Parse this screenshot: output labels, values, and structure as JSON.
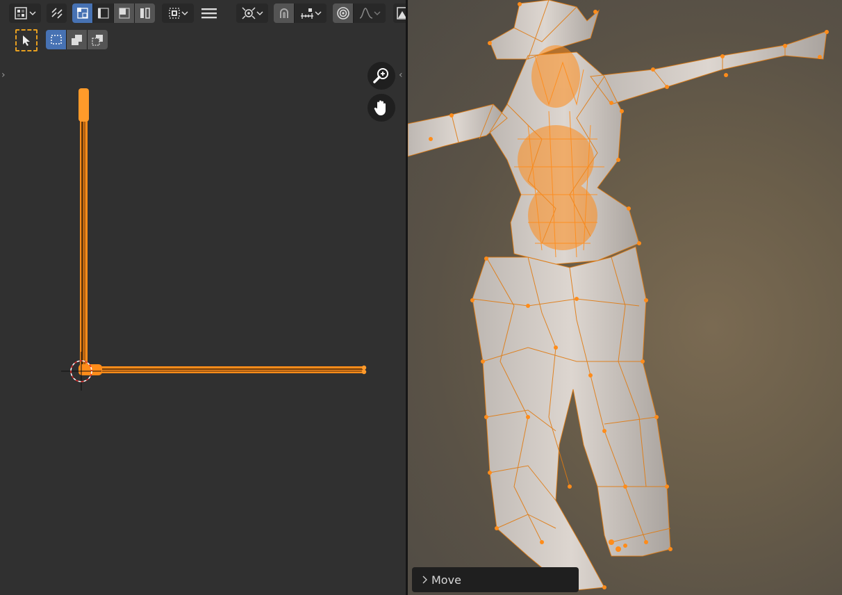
{
  "uv_editor": {
    "toolbar": {
      "editor_type_icon": "uv-editor-icon",
      "sync_icon": "uv-sync-selection-icon",
      "select_modes": [
        "vertex-select-icon",
        "edge-select-icon",
        "face-select-icon",
        "island-select-icon"
      ],
      "sticky_icon": "sticky-selection-icon",
      "menu_icon": "hamburger-menu-icon",
      "pivot_icon": "pivot-point-icon",
      "snap_icon": "snap-magnet-icon",
      "snap_target_icon": "snap-increment-icon",
      "proportional_icon": "proportional-edit-icon",
      "falloff_icon": "falloff-curve-icon"
    },
    "tool_header": {
      "tool_icon": "select-box-tool-icon",
      "modes": [
        "select-new-icon",
        "select-extend-icon",
        "select-subtract-icon"
      ]
    },
    "nav": [
      "zoom-icon",
      "pan-hand-icon"
    ]
  },
  "viewport": {
    "redo_panel": {
      "label": "Move"
    }
  },
  "colors": {
    "accent": "#4772b3",
    "selection": "#ff8c1a",
    "panel_bg": "#303030",
    "header_bg": "#282828"
  }
}
